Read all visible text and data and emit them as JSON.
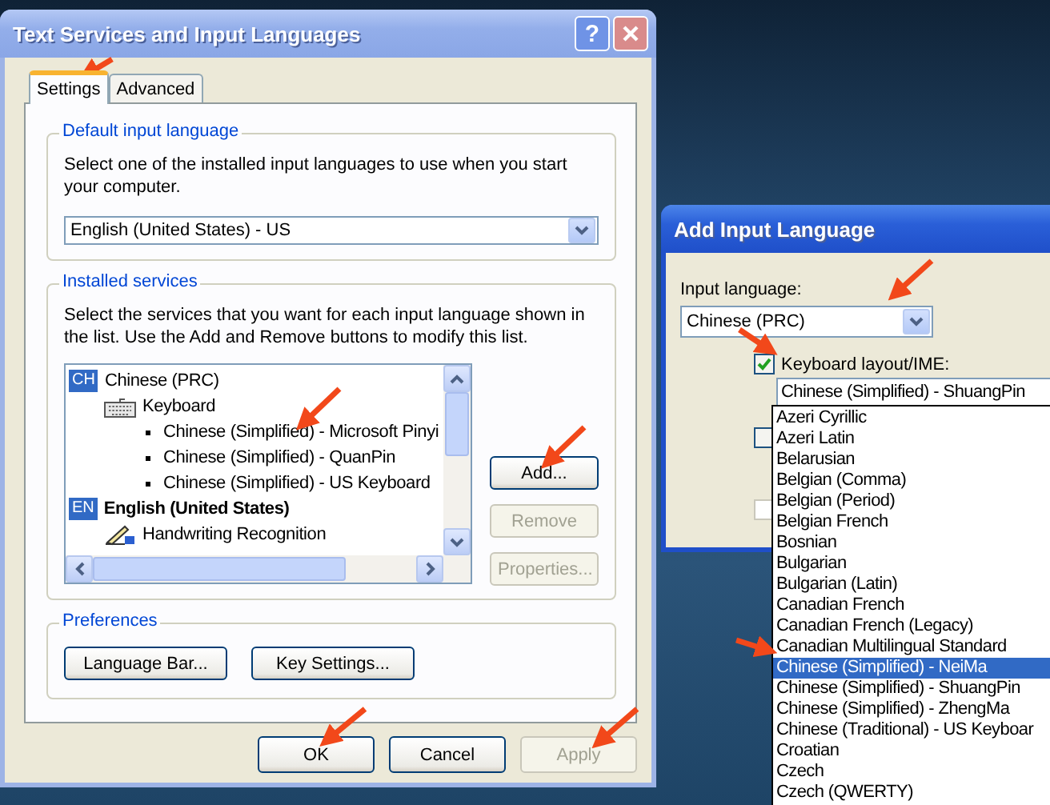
{
  "main_window": {
    "title": "Text Services and Input Languages",
    "help_button": "?",
    "tabs": [
      {
        "label": "Settings",
        "selected": true
      },
      {
        "label": "Advanced",
        "selected": false
      }
    ],
    "default_group": {
      "title": "Default input language",
      "description": "Select one of the installed input languages to use when you start your computer.",
      "value": "English (United States) - US"
    },
    "installed_group": {
      "title": "Installed services",
      "description": "Select the services that you want for each input language shown in the list. Use the Add and Remove buttons to modify this list.",
      "tree": [
        {
          "kind": "language",
          "badge": "CH",
          "label": "Chinese (PRC)",
          "default": false,
          "children": [
            {
              "kind": "keyboard",
              "label": "Keyboard",
              "children": [
                {
                  "kind": "service",
                  "label": "Chinese (Simplified) - Microsoft Pinyi"
                },
                {
                  "kind": "service",
                  "label": "Chinese (Simplified) - QuanPin"
                },
                {
                  "kind": "service",
                  "label": "Chinese (Simplified) - US Keyboard"
                }
              ]
            }
          ]
        },
        {
          "kind": "language",
          "badge": "EN",
          "label": "English (United States)",
          "default": true,
          "children": [
            {
              "kind": "handwriting",
              "label": "Handwriting Recognition"
            }
          ]
        }
      ],
      "buttons": [
        {
          "label": "Add...",
          "disabled": false
        },
        {
          "label": "Remove",
          "disabled": true
        },
        {
          "label": "Properties...",
          "disabled": true
        }
      ]
    },
    "preferences_group": {
      "title": "Preferences",
      "buttons": [
        "Language Bar...",
        "Key Settings..."
      ]
    },
    "dialog_buttons": [
      {
        "label": "OK",
        "disabled": false
      },
      {
        "label": "Cancel",
        "disabled": false
      },
      {
        "label": "Apply",
        "disabled": true
      }
    ]
  },
  "add_window": {
    "title": "Add Input Language",
    "input_language_label": "Input language:",
    "input_language": "Chinese (PRC)",
    "keyboard_checkbox": {
      "label": "Keyboard layout/IME:",
      "checked": true
    },
    "keyboard_value": "Chinese (Simplified) - ShuangPin",
    "other_checkboxes": [
      {
        "checked": false,
        "disabled": false
      },
      {
        "checked": false,
        "disabled": true
      }
    ],
    "dropdown_list": [
      {
        "label": "Azeri Cyrillic",
        "selected": false
      },
      {
        "label": "Azeri Latin",
        "selected": false
      },
      {
        "label": "Belarusian",
        "selected": false
      },
      {
        "label": "Belgian (Comma)",
        "selected": false
      },
      {
        "label": "Belgian (Period)",
        "selected": false
      },
      {
        "label": "Belgian French",
        "selected": false
      },
      {
        "label": "Bosnian",
        "selected": false
      },
      {
        "label": "Bulgarian",
        "selected": false
      },
      {
        "label": "Bulgarian (Latin)",
        "selected": false
      },
      {
        "label": "Canadian French",
        "selected": false
      },
      {
        "label": "Canadian French (Legacy)",
        "selected": false
      },
      {
        "label": "Canadian Multilingual Standard",
        "selected": false
      },
      {
        "label": "Chinese (Simplified) - NeiMa",
        "selected": true
      },
      {
        "label": "Chinese (Simplified) - ShuangPin",
        "selected": false
      },
      {
        "label": "Chinese (Simplified) - ZhengMa",
        "selected": false
      },
      {
        "label": "Chinese (Traditional) - US Keyboar",
        "selected": false
      },
      {
        "label": "Croatian",
        "selected": false
      },
      {
        "label": "Czech",
        "selected": false
      },
      {
        "label": "Czech (QWERTY)",
        "selected": false
      }
    ]
  }
}
